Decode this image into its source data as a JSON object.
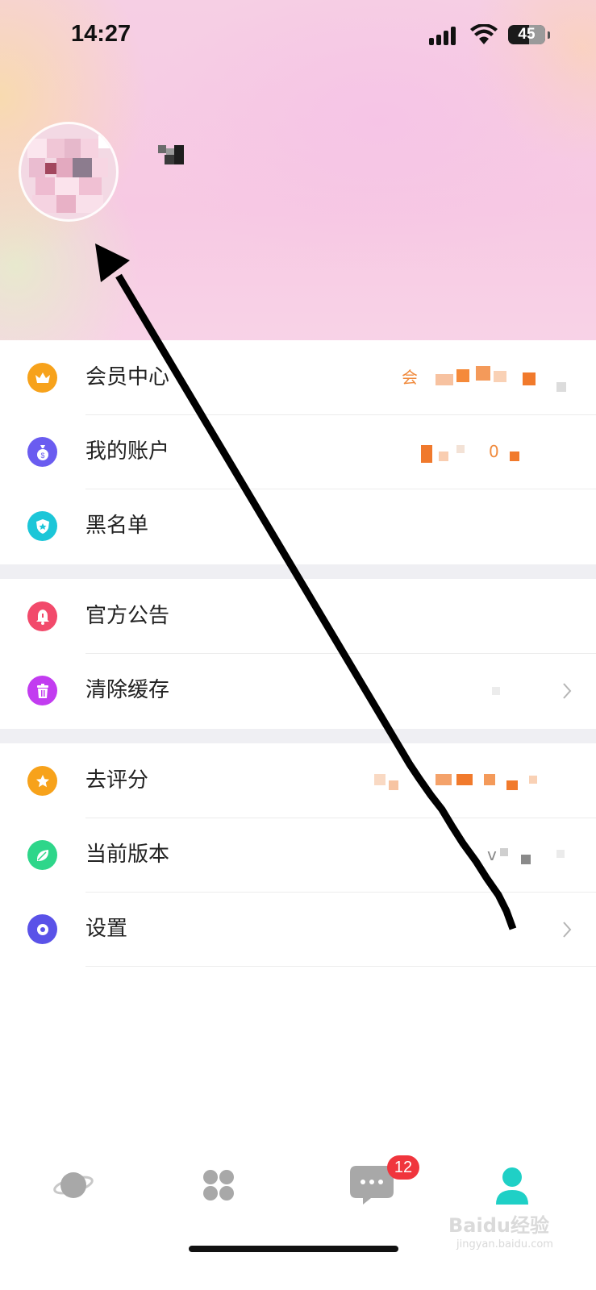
{
  "status_bar": {
    "time": "14:27",
    "battery": "45"
  },
  "menu": {
    "group1": [
      {
        "label": "会员中心",
        "value_fragment": "会",
        "icon": "crown-icon",
        "color": "#f7a21b"
      },
      {
        "label": "我的账户",
        "value_fragment": "0",
        "icon": "money-bag-icon",
        "color": "#6a5cf0"
      },
      {
        "label": "黑名单",
        "icon": "shield-icon",
        "color": "#1cc6d8"
      }
    ],
    "group2": [
      {
        "label": "官方公告",
        "icon": "bell-icon",
        "color": "#f24a6b"
      },
      {
        "label": "清除缓存",
        "icon": "trash-icon",
        "color": "#c23cf0"
      }
    ],
    "group3": [
      {
        "label": "去评分",
        "icon": "star-icon",
        "color": "#f7a21b"
      },
      {
        "label": "当前版本",
        "value_fragment": "v",
        "icon": "leaf-icon",
        "color": "#2ed68a"
      },
      {
        "label": "设置",
        "icon": "settings-icon",
        "color": "#5a52e8"
      }
    ]
  },
  "tabbar": {
    "tabs": [
      {
        "icon": "planet-icon"
      },
      {
        "icon": "grid-icon"
      },
      {
        "icon": "message-icon",
        "badge": "12"
      },
      {
        "icon": "profile-icon",
        "active": true
      }
    ],
    "active_color": "#1fd0c6"
  },
  "watermark": {
    "text": "Baidu经验",
    "sub": "jingyan.baidu.com"
  }
}
